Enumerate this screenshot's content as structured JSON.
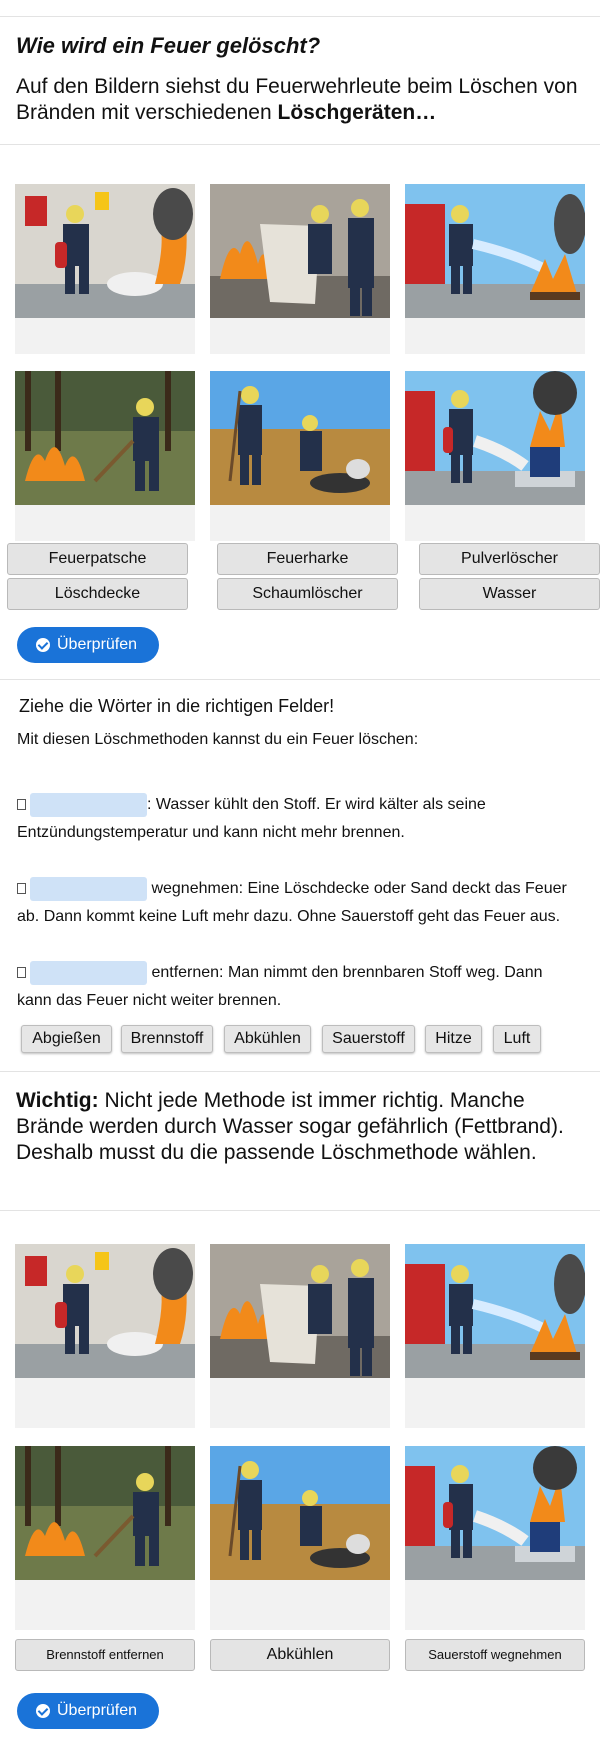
{
  "section1": {
    "title": "Wie wird ein Feuer gelöscht?",
    "intro_plain": "Auf den Bildern siehst du Feuerwehrleute beim Löschen von Bränden mit verschiedenen ",
    "intro_bold": "Löschgeräten…"
  },
  "section2": {
    "images": [
      {
        "icon": "fire-extinguisher-scene-icon"
      },
      {
        "icon": "fire-blanket-scene-icon"
      },
      {
        "icon": "water-hose-scene-icon"
      },
      {
        "icon": "fire-rake-scene-icon"
      },
      {
        "icon": "fire-swatter-scene-icon"
      },
      {
        "icon": "foam-extinguisher-scene-icon"
      }
    ],
    "words": [
      "Feuerpatsche",
      "Feuerharke",
      "Pulverlöscher",
      "Löschdecke",
      "Schaumlöscher",
      "Wasser"
    ],
    "check_label": "Überprüfen"
  },
  "section3": {
    "instruction": "Ziehe die Wörter in die richtigen Felder!",
    "lead": "Mit diesen Löschmethoden kannst du ein Feuer löschen:",
    "item1_after": ": Wasser kühlt den Stoff. Er wird kälter als seine",
    "item1_line2": "Entzündungstemperatur und kann nicht mehr brennen.",
    "item2_after": " wegnehmen: Eine Löschdecke oder Sand deckt das Feuer",
    "item2_line2": "ab. Dann kommt keine Luft mehr dazu. Ohne Sauerstoff geht das Feuer aus.",
    "item3_after": " entfernen: Man nimmt den brennbaren Stoff weg. Dann",
    "item3_line2": "kann das Feuer nicht weiter brennen.",
    "chips": [
      "Abgießen",
      "Brennstoff",
      "Abkühlen",
      "Sauerstoff",
      "Hitze",
      "Luft"
    ]
  },
  "section4": {
    "important_bold": "Wichtig:",
    "important_text": " Nicht jede Methode ist immer richtig. Manche Brände werden durch Wasser sogar gefährlich (Fettbrand). Deshalb musst du die passende Löschmethode wählen."
  },
  "section5": {
    "words": [
      "Brennstoff entfernen",
      "Abkühlen",
      "Sauerstoff wegnehmen"
    ],
    "check_label": "Überprüfen"
  },
  "colors": {
    "accent": "#1a73d8",
    "gap_field": "#cfe2f7"
  }
}
